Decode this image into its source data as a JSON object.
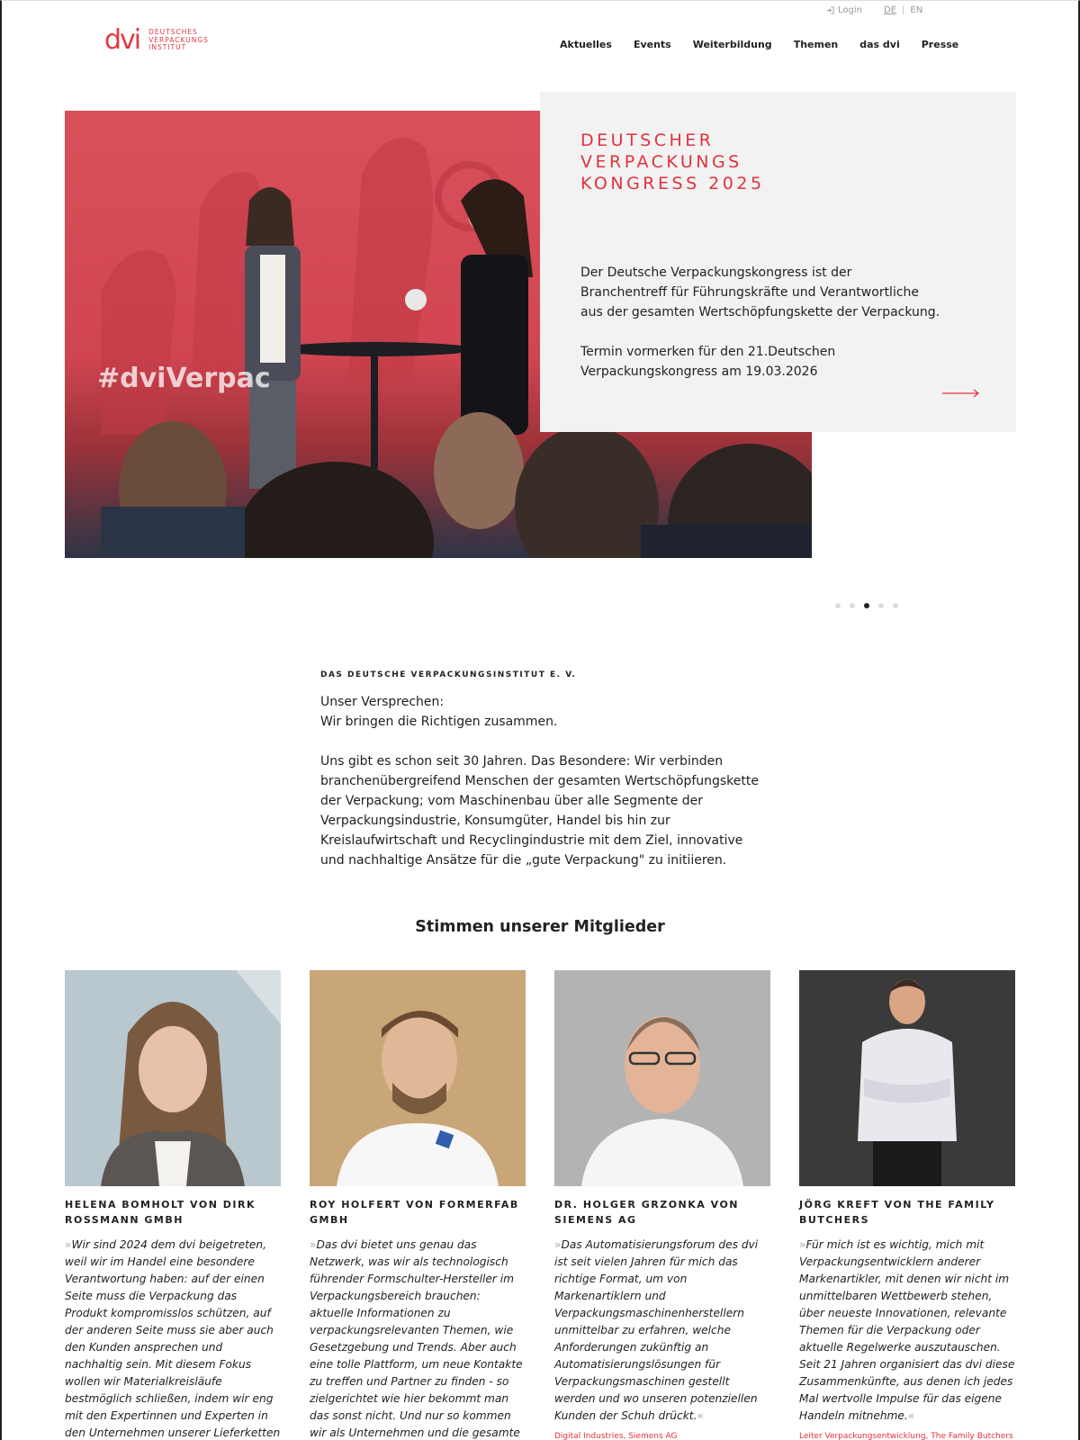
{
  "header": {
    "login_label": "Login",
    "lang_de": "DE",
    "lang_separator": "|",
    "lang_en": "EN",
    "logo_mark": "dvi",
    "logo_lines": [
      "DEUTSCHES",
      "VERPACKUNGS",
      "INSTITUT"
    ],
    "nav": [
      "Aktuelles",
      "Events",
      "Weiterbildung",
      "Themen",
      "das dvi",
      "Presse"
    ]
  },
  "hero": {
    "photo_hashtag": "#dviVerpac",
    "title_lines": [
      "DEUTSCHER",
      "VERPACKUNGS",
      "KONGRESS 2025"
    ],
    "paragraph1": "Der Deutsche Verpackungskongress ist der Branchentreff für Führungskräfte und Verantwortliche aus der gesamten Wertschöpfungskette der Verpackung.",
    "paragraph2": "Termin vormerken für den 21.Deutschen Verpackungskongress am 19.03.2026",
    "arrow_icon": "arrow-right-icon",
    "slides_total": 5,
    "slide_active": 3
  },
  "intro": {
    "kicker": "DAS DEUTSCHE VERPACKUNGSINSTITUT E. V.",
    "lead_line1": "Unser Versprechen:",
    "lead_line2": "Wir bringen die Richtigen zusammen.",
    "body": "Uns gibt es schon seit 30 Jahren. Das Besondere: Wir verbinden branchenübergreifend Menschen der gesamten Wertschöpfungskette der Verpackung; vom Maschinenbau über alle Segmente der Verpackungsindustrie, Konsumgüter, Handel bis hin zur Kreislaufwirtschaft und Recyclingindustrie mit dem Ziel, innovative und nachhaltige Ansätze für die „gute Verpackung\" zu initiieren."
  },
  "members_heading": "Stimmen unserer Mitglieder",
  "quote_open": "»",
  "quote_close": "«",
  "members": [
    {
      "name": "HELENA BOMHOLT VON DIRK ROSSMANN GMBH",
      "quote": "Wir sind 2024 dem dvi beigetreten, weil wir im Handel eine besondere Verantwortung haben: auf der einen Seite muss die Verpackung das Produkt kompromisslos schützen, auf der anderen Seite muss sie aber auch den Kunden ansprechen und nachhaltig sein. Mit diesem Fokus wollen wir Materialkreisläufe bestmöglich schließen, indem wir eng mit den Expertinnen und Experten in den Unternehmen unserer Lieferketten",
      "role": ""
    },
    {
      "name": "ROY HOLFERT VON FORMERFAB GMBH",
      "quote": "Das dvi bietet uns genau das Netzwerk, was wir als technologisch führender Formschulter-Hersteller im Verpackungsbereich brauchen: aktuelle Informationen zu verpackungsrelevanten Themen, wie Gesetzgebung und Trends. Aber auch eine tolle Plattform, um neue Kontakte zu treffen und Partner zu finden - so zielgerichtet wie hier bekommt man das sonst nicht. Und nur so kommen wir als Unternehmen und die gesamte",
      "role": ""
    },
    {
      "name": "DR. HOLGER GRZONKA VON SIEMENS AG",
      "quote": "Das Automatisierungsforum des dvi ist seit vielen Jahren für mich das richtige Format, um von Markenartiklern und Verpackungsmaschinenherstellern unmittelbar zu erfahren, welche Anforderungen zukünftig an Automatisierungslösungen für Verpackungsmaschinen gestellt werden und wo unseren potenziellen Kunden der Schuh drückt.",
      "role": "Digital Industries, Siemens AG"
    },
    {
      "name": "JÖRG KREFT VON THE FAMILY BUTCHERS",
      "quote": "Für mich ist es wichtig, mich mit Verpackungsentwicklern anderer Markenartikler, mit denen wir nicht im unmittelbaren Wettbewerb stehen, über neueste Innovationen, relevante Themen für die Verpackung oder aktuelle Regelwerke auszutauschen. Seit 21 Jahren organisiert das dvi diese Zusammenkünfte, aus denen ich jedes Mal wertvolle Impulse für das eigene Handeln mitnehme.",
      "role": "Leiter Verpackungsentwicklung, The Family Butchers"
    }
  ],
  "colors": {
    "accent": "#e2323c",
    "card_bg": "#f2f2f2",
    "text": "#222222"
  }
}
